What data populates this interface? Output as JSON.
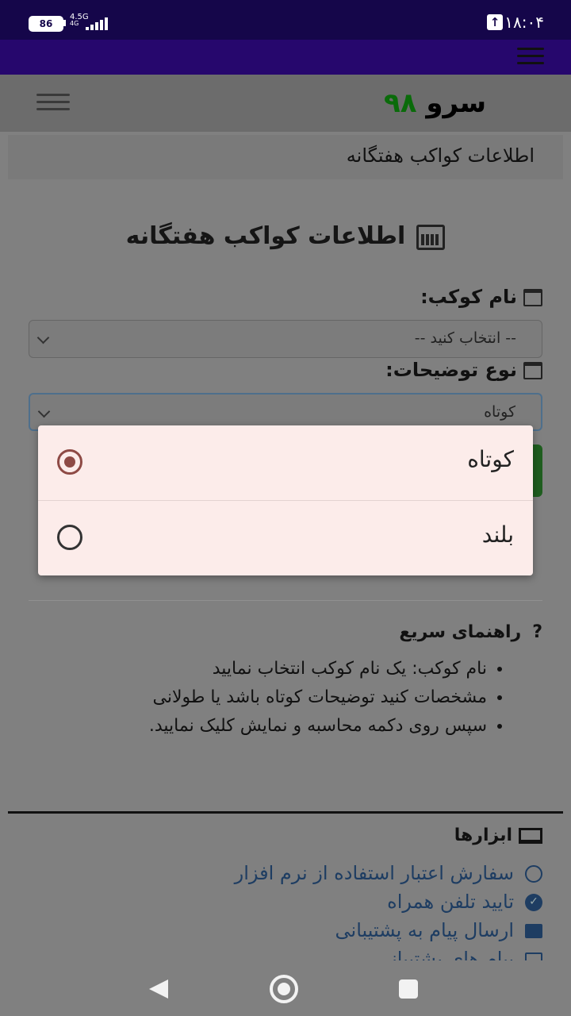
{
  "status_bar": {
    "battery": "86",
    "network": "4.5G",
    "network_sub": "4G",
    "time": "۱۸:۰۴"
  },
  "app": {
    "logo_word": "سرو",
    "logo_number": "۹۸"
  },
  "breadcrumb": "اطلاعات کواکب هفتگانه",
  "page_title": "اطلاعات کواکب هفتگانه",
  "form": {
    "planet_label": "نام کوکب:",
    "planet_value": "-- انتخاب کنید --",
    "desc_label": "نوع توضیحات:",
    "desc_value": "کوتاه"
  },
  "dropdown": {
    "options": [
      {
        "label": "کوتاه",
        "selected": true
      },
      {
        "label": "بلند",
        "selected": false
      }
    ]
  },
  "help": {
    "title": "راهنمای سریع",
    "icon_char": "?",
    "items": [
      "نام کوکب: یک نام کوکب انتخاب نمایید",
      "مشخصات کنید توضیحات کوتاه باشد یا طولانی",
      "سپس روی دکمه محاسبه و نمایش کلیک نمایید."
    ]
  },
  "tools": {
    "title": "ابزارها",
    "links": [
      {
        "label": "سفارش اعتبار استفاده از نرم افزار",
        "icon": "clock-icon"
      },
      {
        "label": "تایید تلفن همراه",
        "icon": "check-circle-icon"
      },
      {
        "label": "ارسال پیام به پشتیبانی",
        "icon": "envelope-icon"
      },
      {
        "label": "پیام های پشتیبانی",
        "icon": "envelope-outline-icon"
      }
    ]
  },
  "colors": {
    "status_bar": "#15064a",
    "nav_strip": "#26076d",
    "logo_number": "#0a6b0a",
    "link": "#1e3d62",
    "radio_selected": "#8e4a45",
    "dropdown_bg": "#fcecea"
  }
}
